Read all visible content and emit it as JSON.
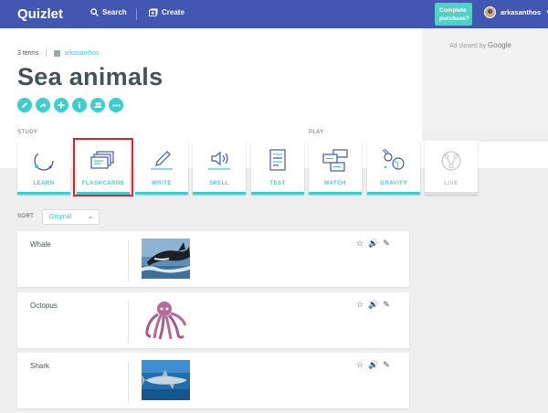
{
  "topbar": {
    "logo": "Quizlet",
    "search_label": "Search",
    "create_label": "Create",
    "cta_line1": "Complete",
    "cta_line2": "purchase?",
    "username": "arkasanthos"
  },
  "set": {
    "term_count": "3 terms",
    "owner": "arkasanthos",
    "title": "Sea animals",
    "actions": [
      "edit-icon",
      "share-icon",
      "add-icon",
      "info-icon",
      "group-icon",
      "more-icon"
    ]
  },
  "ad": {
    "closed_prefix": "Ad closed by",
    "closed_brand": "Google"
  },
  "sections": {
    "study": "STUDY",
    "play": "PLAY"
  },
  "modes": [
    {
      "label": "LEARN",
      "icon": "learn-icon"
    },
    {
      "label": "FLASHCARDS",
      "icon": "flashcards-icon"
    },
    {
      "label": "WRITE",
      "icon": "write-icon"
    },
    {
      "label": "SPELL",
      "icon": "spell-icon"
    },
    {
      "label": "TEST",
      "icon": "test-icon"
    },
    {
      "label": "MATCH",
      "icon": "match-icon"
    },
    {
      "label": "GRAVITY",
      "icon": "gravity-icon"
    },
    {
      "label": "LIVE",
      "icon": "live-icon"
    }
  ],
  "sort": {
    "label": "SORT",
    "value": "Original"
  },
  "terms": [
    {
      "term": "Whale",
      "image": "whale-image"
    },
    {
      "term": "Octopus",
      "image": "octopus-image"
    },
    {
      "term": "Shark",
      "image": "shark-image"
    }
  ],
  "colors": {
    "brand": "#4257b2",
    "accent": "#3ccfcf",
    "highlight": "#e0252f",
    "text": "#455358"
  }
}
